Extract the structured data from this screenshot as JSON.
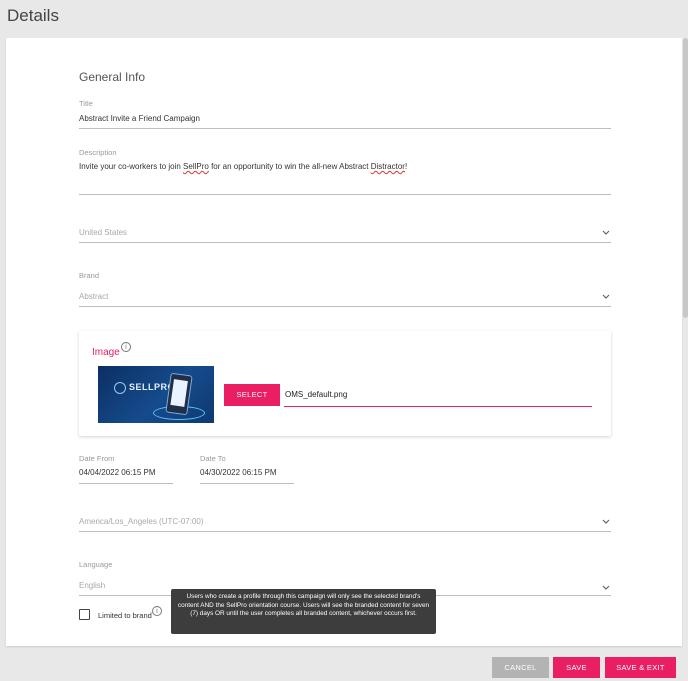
{
  "header": {
    "title": "Details"
  },
  "general": {
    "section_title": "General Info"
  },
  "title_field": {
    "label": "Title",
    "value": "Abstract Invite a Friend Campaign"
  },
  "description_field": {
    "label": "Description",
    "value_part1": "Invite your co-workers to join ",
    "value_word1": "SellPro",
    "value_part2": " for an opportunity to win the all-new Abstract ",
    "value_word2": "Distractor",
    "value_part3": "!"
  },
  "country_field": {
    "placeholder": "United States",
    "icon": "chevron-down-icon"
  },
  "brand_field": {
    "label": "Brand",
    "placeholder": "Abstract",
    "icon": "chevron-down-icon"
  },
  "image_section": {
    "label": "Image",
    "info_icon": "info-icon",
    "thumbnail_text": "SELLPRO",
    "select_label": "SELECT",
    "file_value": "OMS_default.png"
  },
  "date_from": {
    "label": "Date From",
    "value": "04/04/2022 06:15 PM"
  },
  "date_to": {
    "label": "Date To",
    "value": "04/30/2022 06:15 PM"
  },
  "timezone_field": {
    "placeholder": "America/Los_Angeles (UTC-07:00)",
    "icon": "chevron-down-icon"
  },
  "language_field": {
    "label": "Language",
    "placeholder": "English",
    "icon": "chevron-down-icon"
  },
  "limited_to_brand": {
    "label": "Limited to brand",
    "checked": false,
    "info_icon": "info-icon"
  },
  "tooltip": {
    "text": "Users who create a profile through this campaign will only see the selected brand's content AND the SellPro orientation course. Users will see the branded content for seven (7) days OR until the user completes all branded content, whichever occurs first."
  },
  "footer": {
    "cancel_label": "CANCEL",
    "save_label": "SAVE",
    "save_exit_label": "SAVE & EXIT"
  },
  "colors": {
    "accent": "#e91e63",
    "disabled": "#b3b3b3",
    "background": "#e8e8e8",
    "tooltip": "#3d3d3d"
  }
}
